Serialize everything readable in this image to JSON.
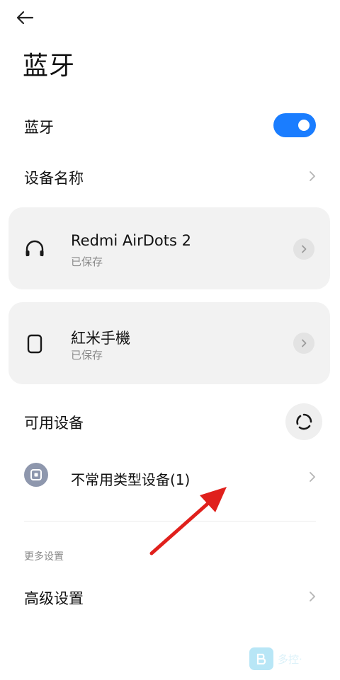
{
  "header": {
    "title": "蓝牙"
  },
  "bluetooth_toggle": {
    "label": "蓝牙",
    "enabled": true,
    "accent": "#1a7dff"
  },
  "device_name_row": {
    "label": "设备名称"
  },
  "saved_devices": [
    {
      "name": "Redmi AirDots 2",
      "status": "已保存",
      "icon": "headphones-icon"
    },
    {
      "name": "紅米手機",
      "status": "已保存",
      "icon": "phone-icon"
    }
  ],
  "available_section": {
    "title": "可用设备"
  },
  "available_devices": [
    {
      "name": "不常用类型设备(1)",
      "icon": "device-type-icon"
    }
  ],
  "more_settings": {
    "header": "更多设置",
    "advanced_label": "高级设置"
  },
  "annotation": {
    "color": "#e0201c"
  },
  "watermark": {
    "text": "多控·"
  }
}
